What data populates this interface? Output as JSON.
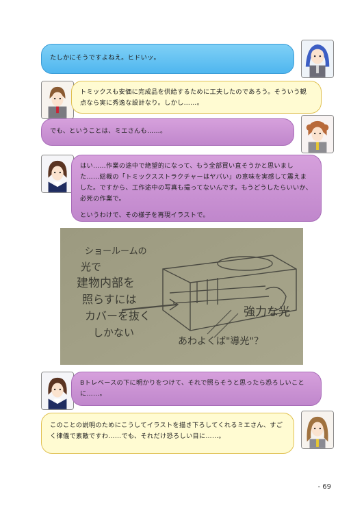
{
  "bubbles": [
    {
      "text": "たしかにそうですよねえ。ヒドいッ。"
    },
    {
      "text": "トミックスも安価に完成品を供給するために工夫したのであろう。そういう観点なら実に秀逸な設計なり。しかし……。"
    },
    {
      "text": "でも、ということは、ミエさんも……。"
    },
    {
      "text": "はい……作業の途中で絶望的になって、もう全部買い直そうかと思いました……総裁の「トミックスストラクチャーはヤバい」の意味を実感して震えました。ですから、工作途中の写真も撮ってないんです。もうどうしたらいいか、必死の作業で。",
      "text2": "というわけで、その様子を再現イラストで。"
    },
    {
      "text": "Bトレベースの下に明かりをつけて、それで照らそうと思ったら恐ろしいことに……。"
    },
    {
      "text": "このことの説明のためにこうしてイラストを描き下ろしてくれるミエさん、すごく律儀で素敵ですわ……でも、それだけ恐ろしい目に……。"
    }
  ],
  "photo": {
    "handwriting_lines": [
      "ショールームの",
      "光で",
      "建物内部を",
      "照らすには",
      "カバーを抜く",
      "しかない"
    ],
    "label_right": "強力な光",
    "label_bottom": "あわよくば\"導光\"？"
  },
  "page_number": "- 69",
  "colors": {
    "blue": "#5ab9ef",
    "yellow": "#fffbd2",
    "purple": "#c98fd3"
  }
}
